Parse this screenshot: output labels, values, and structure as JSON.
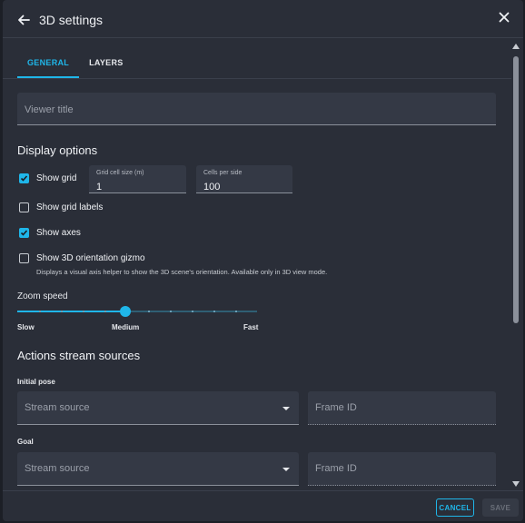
{
  "header": {
    "title": "3D settings",
    "back_icon": "arrow-left-icon",
    "close_icon": "close-icon"
  },
  "tabs": [
    {
      "label": "GENERAL",
      "active": true
    },
    {
      "label": "LAYERS",
      "active": false
    }
  ],
  "viewer_title": {
    "placeholder": "Viewer title",
    "value": ""
  },
  "display_options": {
    "title": "Display options",
    "show_grid": {
      "label": "Show grid",
      "checked": true
    },
    "grid_cell_size": {
      "label": "Grid cell size (m)",
      "value": "1"
    },
    "cells_per_side": {
      "label": "Cells per side",
      "value": "100"
    },
    "show_grid_labels": {
      "label": "Show grid labels",
      "checked": false
    },
    "show_axes": {
      "label": "Show axes",
      "checked": true
    },
    "show_gizmo": {
      "label": "Show 3D orientation gizmo",
      "checked": false,
      "description": "Displays a visual axis helper to show the 3D scene's orientation. Available only in 3D view mode."
    }
  },
  "zoom_speed": {
    "label": "Zoom speed",
    "value": 0.45,
    "min_label": "Slow",
    "mid_label": "Medium",
    "max_label": "Fast"
  },
  "actions": {
    "title": "Actions stream sources",
    "initial_pose": {
      "label": "Initial pose",
      "source_placeholder": "Stream source",
      "frame_placeholder": "Frame ID"
    },
    "goal": {
      "label": "Goal",
      "source_placeholder": "Stream source",
      "frame_placeholder": "Frame ID"
    }
  },
  "footer": {
    "cancel_label": "CANCEL",
    "save_label": "SAVE"
  },
  "colors": {
    "accent": "#1fb6e9",
    "surface": "#2a2e38",
    "field": "#343945"
  }
}
